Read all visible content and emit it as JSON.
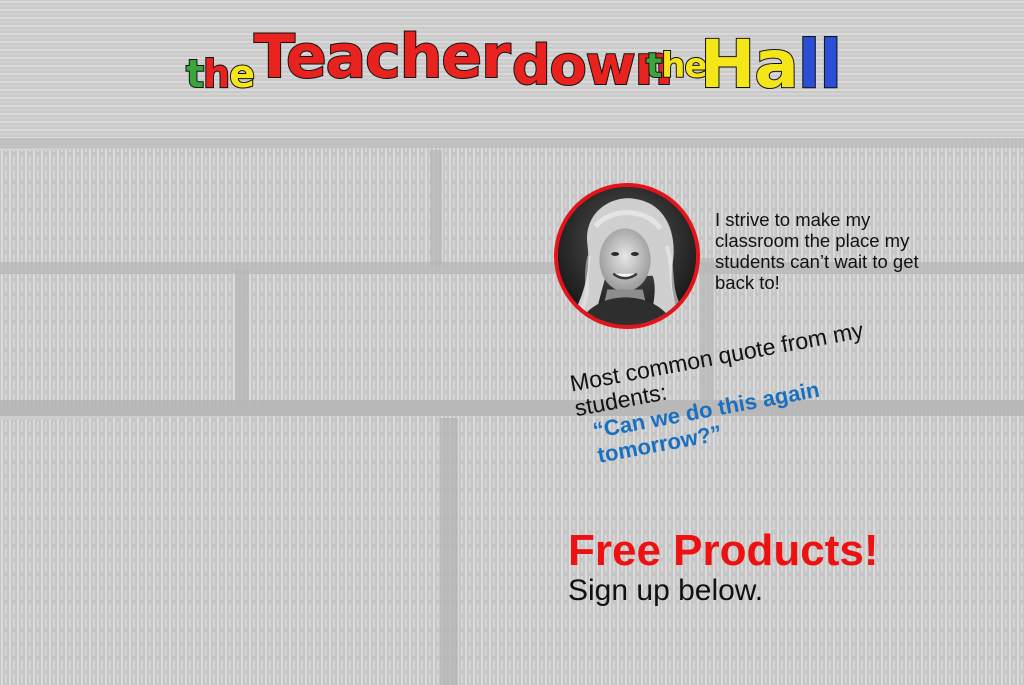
{
  "logo": {
    "word1": "the",
    "word2": "Teacher",
    "word3": "down",
    "word4": "the",
    "word5": "Hall"
  },
  "colors": {
    "logo_green": "#3aa63a",
    "logo_red": "#e8231f",
    "logo_yellow": "#f5e61a",
    "logo_blue": "#2a4fd6",
    "avatar_border": "#e3141a",
    "quote_blue": "#1a6fc0",
    "headline_red": "#ee1111"
  },
  "bio": "I strive to make my classroom the place my students can’t wait to get back to!",
  "quote": {
    "intro": "Most common quote from my students:",
    "text": "“Can we do this again tomorrow?”"
  },
  "cta": {
    "headline": "Free Products!",
    "subtext": "Sign up below."
  },
  "avatar": {
    "icon": "portrait-photo"
  }
}
